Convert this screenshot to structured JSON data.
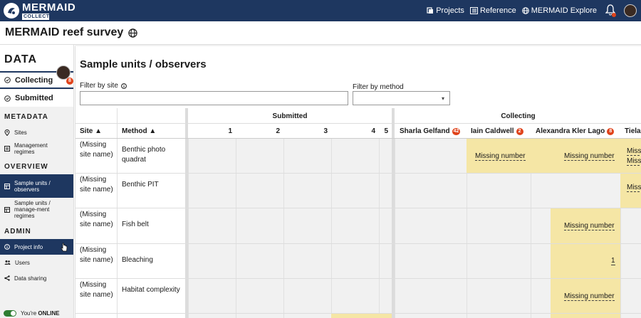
{
  "app": {
    "logo_main": "MERMAID",
    "logo_sub": "COLLECT",
    "nav": [
      {
        "label": "Projects",
        "icon": "projects-icon"
      },
      {
        "label": "Reference",
        "icon": "reference-icon"
      },
      {
        "label": "MERMAID Explore",
        "icon": "globe-icon"
      }
    ]
  },
  "project": {
    "title": "MERMAID reef survey"
  },
  "sidebar": {
    "data_heading": "DATA",
    "collecting_label": "Collecting",
    "collecting_count": "8",
    "submitted_label": "Submitted",
    "metadata_heading": "METADATA",
    "metadata_items": [
      "Sites",
      "Management regimes"
    ],
    "overview_heading": "OVERVIEW",
    "overview_items": [
      "Sample units / observers",
      "Sample units / manage-ment regimes"
    ],
    "admin_heading": "ADMIN",
    "admin_items": [
      "Project info",
      "Users",
      "Data sharing"
    ],
    "online_prefix": "You're",
    "online_status": "ONLINE"
  },
  "page": {
    "title": "Sample units / observers",
    "filter_site_label": "Filter by site",
    "filter_method_label": "Filter by method",
    "filter_site_value": "",
    "filter_method_value": ""
  },
  "table": {
    "group_submitted": "Submitted",
    "group_collecting": "Collecting",
    "col_site": "Site ▲",
    "col_method": "Method ▲",
    "submitted_cols": [
      "1",
      "2",
      "3",
      "4",
      "5"
    ],
    "collecting_cols": [
      {
        "name": "Sharla Gelfand",
        "count": "42"
      },
      {
        "name": "Iain Caldwell",
        "count": "2"
      },
      {
        "name": "Alexandra Kler Lago",
        "count": "8"
      },
      {
        "name": "Tiela",
        "count": ""
      }
    ],
    "rows": [
      {
        "site": "(Missing site name)",
        "method": "Benthic photo quadrat"
      },
      {
        "site": "(Missing site name)",
        "method": "Benthic PIT"
      },
      {
        "site": "(Missing site name)",
        "method": "Fish belt"
      },
      {
        "site": "(Missing site name)",
        "method": "Bleaching"
      },
      {
        "site": "(Missing site name)",
        "method": "Habitat complexity"
      }
    ],
    "cells": {
      "r0_iain": "Missing number",
      "r0_alexandra": "Missing number",
      "r0_tiela_a": "Missi",
      "r0_tiela_b": "Missi",
      "r1_tiela": "Missi",
      "r2_alexandra": "Missing number",
      "r3_alexandra": "1",
      "r4_alexandra": "Missing number"
    }
  },
  "colors": {
    "brand": "#1e3760",
    "badge": "#e0431b",
    "highlight": "#f5e6a5",
    "online": "#2e7d32"
  }
}
